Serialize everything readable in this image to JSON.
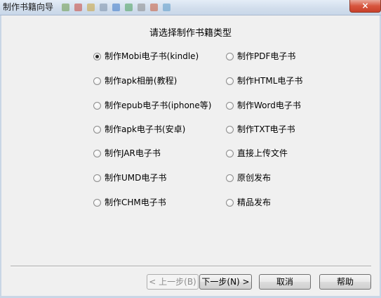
{
  "window": {
    "title": "制作书籍向导",
    "close_symbol": "×"
  },
  "heading": "请选择制作书籍类型",
  "options": [
    {
      "label": "制作Mobi电子书(kindle)",
      "checked": true
    },
    {
      "label": "制作PDF电子书",
      "checked": false
    },
    {
      "label": "制作apk相册(教程)",
      "checked": false
    },
    {
      "label": "制作HTML电子书",
      "checked": false
    },
    {
      "label": "制作epub电子书(iphone等)",
      "checked": false
    },
    {
      "label": "制作Word电子书",
      "checked": false
    },
    {
      "label": "制作apk电子书(安卓)",
      "checked": false
    },
    {
      "label": "制作TXT电子书",
      "checked": false
    },
    {
      "label": "制作JAR电子书",
      "checked": false
    },
    {
      "label": "直接上传文件",
      "checked": false
    },
    {
      "label": "制作UMD电子书",
      "checked": false
    },
    {
      "label": "原创发布",
      "checked": false
    },
    {
      "label": "制作CHM电子书",
      "checked": false
    },
    {
      "label": "精品发布",
      "checked": false
    }
  ],
  "buttons": {
    "back": "< 上一步(B)",
    "next": "下一步(N) >",
    "cancel": "取消",
    "help": "帮助"
  },
  "colors": {
    "dialog_bg": "#f0f0f0",
    "title_bar": "#d2deec",
    "close_button": "#d7553e"
  },
  "icons": {
    "close": "close-icon"
  }
}
